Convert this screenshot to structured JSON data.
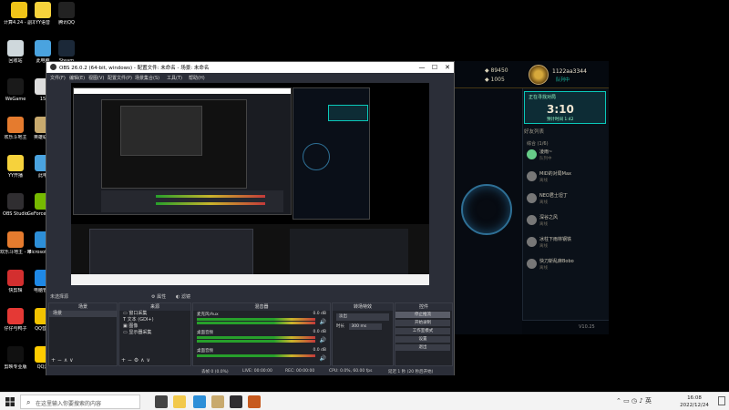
{
  "desktop": {
    "icons": [
      {
        "label": "计算4.24 - 副本111",
        "color": "#f0c419"
      },
      {
        "label": "YY语音",
        "color": "#f6d23c"
      },
      {
        "label": "腾讯QQ",
        "color": "#222"
      },
      {
        "label": "回收站",
        "color": "#cfd8dc"
      },
      {
        "label": "此电脑",
        "color": "#4aa3df"
      },
      {
        "label": "Steam",
        "color": "#1b2838"
      },
      {
        "label": "WeGame",
        "color": "#1a1a1a"
      },
      {
        "label": "15",
        "color": "#ddd"
      },
      {
        "label": "欢乐斗地主",
        "color": "#e57b2e"
      },
      {
        "label": "英雄联盟",
        "color": "#c8aa6e"
      },
      {
        "label": "YY开播",
        "color": "#f6d23c"
      },
      {
        "label": "此电",
        "color": "#4aa3df"
      },
      {
        "label": "OBS Studio",
        "color": "#302e31"
      },
      {
        "label": "GeForce Experience",
        "color": "#76b900"
      },
      {
        "label": "欢乐斗地主 - 本地残局版",
        "color": "#e57b2e"
      },
      {
        "label": "Microsoft Edge",
        "color": "#2d8fd8"
      },
      {
        "label": "快剪辑",
        "color": "#d32f2f"
      },
      {
        "label": "电脑管家",
        "color": "#1e88e5"
      },
      {
        "label": "仔仔与鸭子",
        "color": "#e53935"
      },
      {
        "label": "QQ音乐",
        "color": "#f2c200"
      },
      {
        "label": "剪映专业版",
        "color": "#111"
      },
      {
        "label": "QQ游",
        "color": "#ffcc00"
      }
    ]
  },
  "obs": {
    "title": "OBS 26.0.2 (64-bit, windows) - 配置文件: 未命名 - 场景: 未命名",
    "menus": [
      "文件(F)",
      "编辑(E)",
      "视图(V)",
      "配置文件(P)",
      "场景集合(S)",
      "工具(T)",
      "帮助(H)"
    ],
    "window_buttons": {
      "min": "—",
      "max": "☐",
      "close": "✕"
    },
    "source_bar": {
      "current": "未选择源",
      "properties": "属性",
      "filters": "滤镜"
    },
    "docks": {
      "scenes": {
        "title": "场景",
        "items": [
          "场景"
        ]
      },
      "sources": {
        "title": "来源",
        "items": [
          "窗口采集",
          "文本 (GDI+)",
          "图像",
          "显示器采集"
        ]
      },
      "mixer": {
        "title": "混音器",
        "channels": [
          {
            "name": "麦克风/Aux",
            "level": "0.0 dB"
          },
          {
            "name": "桌面音频",
            "level": "0.0 dB"
          },
          {
            "name": "桌面音频",
            "level": "0.0 dB"
          }
        ]
      },
      "transitions": {
        "title": "转场特效",
        "type": "淡出",
        "duration_label": "时长",
        "duration": "300 ms"
      },
      "controls": {
        "title": "控件",
        "buttons": [
          "停止推流",
          "开始录制",
          "工作室模式",
          "设置",
          "退出"
        ]
      }
    },
    "status": {
      "dropped": "丢帧 0 (0.0%)",
      "live": "LIVE: 00:00:00",
      "rec": "REC: 00:00:00",
      "cpu": "CPU: 0.0%, 60.00 fps",
      "stream": "延迟 1 秒 (20 秒后开始)"
    }
  },
  "lol": {
    "be": "89450",
    "rp": "1005",
    "player_name": "1122aa3344",
    "player_status": "队列中",
    "queue_title": "正在寻找对局",
    "queue_time": "3:10",
    "queue_sub": "预计时间 1:42",
    "friends_header": "好友列表",
    "group_label": "综合 (1/6)",
    "friends": [
      {
        "name": "凌雨~",
        "status": "队列中",
        "color": "#6c8"
      },
      {
        "name": "MID的对局Max",
        "status": "离线",
        "color": "#777"
      },
      {
        "name": "NEO君士坦丁",
        "status": "离线",
        "color": "#777"
      },
      {
        "name": "深谷之风",
        "status": "离线",
        "color": "#777"
      },
      {
        "name": "冰柱下雨林钢铁",
        "status": "离线",
        "color": "#777"
      },
      {
        "name": "快刀斩乱麻Bobo",
        "status": "离线",
        "color": "#777"
      }
    ],
    "version": "V10.25"
  },
  "taskbar": {
    "search_placeholder": "在这里输入你要搜索的内容",
    "time": "16:08",
    "date": "2022/12/24",
    "apps": [
      {
        "name": "task-view-icon",
        "color": "#444"
      },
      {
        "name": "file-explorer-icon",
        "color": "#f2c94c"
      },
      {
        "name": "edge-icon",
        "color": "#2d8fd8"
      },
      {
        "name": "lol-icon",
        "color": "#c8aa6e"
      },
      {
        "name": "obs-icon",
        "color": "#302e31"
      },
      {
        "name": "app-icon",
        "color": "#c75a1e"
      }
    ]
  }
}
